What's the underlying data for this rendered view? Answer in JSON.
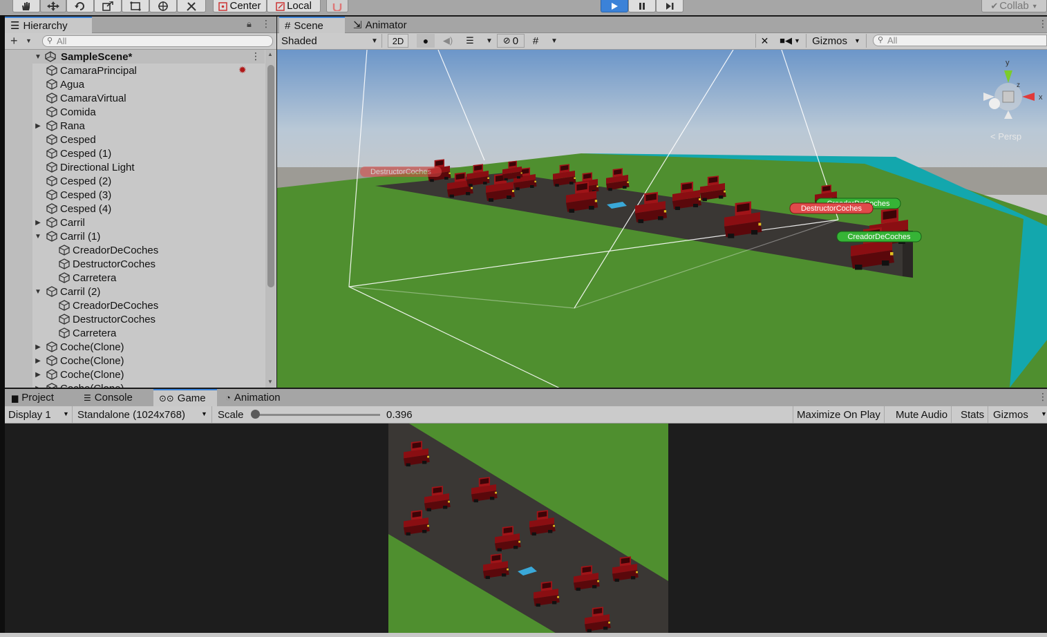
{
  "toolbar": {
    "pivot_label": "Center",
    "space_label": "Local",
    "collab_label": "Collab",
    "play_active": true
  },
  "hierarchy": {
    "tab_label": "Hierarchy",
    "search_placeholder": "All",
    "scene_name": "SampleScene*",
    "items": [
      {
        "label": "CamaraPrincipal",
        "depth": 1,
        "arrow": ""
      },
      {
        "label": "Agua",
        "depth": 1,
        "arrow": ""
      },
      {
        "label": "CamaraVirtual",
        "depth": 1,
        "arrow": ""
      },
      {
        "label": "Comida",
        "depth": 1,
        "arrow": ""
      },
      {
        "label": "Rana",
        "depth": 1,
        "arrow": "collapsed"
      },
      {
        "label": "Cesped",
        "depth": 1,
        "arrow": ""
      },
      {
        "label": "Cesped (1)",
        "depth": 1,
        "arrow": ""
      },
      {
        "label": "Directional Light",
        "depth": 1,
        "arrow": ""
      },
      {
        "label": "Cesped (2)",
        "depth": 1,
        "arrow": ""
      },
      {
        "label": "Cesped (3)",
        "depth": 1,
        "arrow": ""
      },
      {
        "label": "Cesped (4)",
        "depth": 1,
        "arrow": ""
      },
      {
        "label": "Carril",
        "depth": 1,
        "arrow": "collapsed"
      },
      {
        "label": "Carril (1)",
        "depth": 1,
        "arrow": "expanded"
      },
      {
        "label": "CreadorDeCoches",
        "depth": 2,
        "arrow": ""
      },
      {
        "label": "DestructorCoches",
        "depth": 2,
        "arrow": ""
      },
      {
        "label": "Carretera",
        "depth": 2,
        "arrow": ""
      },
      {
        "label": "Carril (2)",
        "depth": 1,
        "arrow": "expanded"
      },
      {
        "label": "CreadorDeCoches",
        "depth": 2,
        "arrow": ""
      },
      {
        "label": "DestructorCoches",
        "depth": 2,
        "arrow": ""
      },
      {
        "label": "Carretera",
        "depth": 2,
        "arrow": ""
      },
      {
        "label": "Coche(Clone)",
        "depth": 1,
        "arrow": "collapsed"
      },
      {
        "label": "Coche(Clone)",
        "depth": 1,
        "arrow": "collapsed"
      },
      {
        "label": "Coche(Clone)",
        "depth": 1,
        "arrow": "collapsed"
      },
      {
        "label": "Coche(Clone)",
        "depth": 1,
        "arrow": "collapsed"
      }
    ]
  },
  "scene": {
    "tab_scene": "Scene",
    "tab_animator": "Animator",
    "shading_mode": "Shaded",
    "mode_2d": "2D",
    "hidden_count": "0",
    "gizmos_label": "Gizmos",
    "search_placeholder": "All",
    "persp_label": "< Persp",
    "labels": {
      "destructor_far": "DestructorCoches",
      "destructor_near": "DestructorCoches",
      "creador_far": "CreadorDeCoches",
      "creador_near": "CreadorDeCoches"
    }
  },
  "bottom": {
    "tabs": {
      "project": "Project",
      "console": "Console",
      "game": "Game",
      "animation": "Animation"
    },
    "display": "Display 1",
    "resolution": "Standalone (1024x768)",
    "scale_label": "Scale",
    "scale_value": "0.396",
    "scale_fraction": 0.0,
    "maximize": "Maximize On Play",
    "mute": "Mute Audio",
    "stats": "Stats",
    "gizmos": "Gizmos"
  },
  "colors": {
    "grass": "#4f8f2f",
    "road": "#3a3734",
    "water": "#13a7ad",
    "car": "#8a0e12",
    "accent": "#3b82d8"
  }
}
